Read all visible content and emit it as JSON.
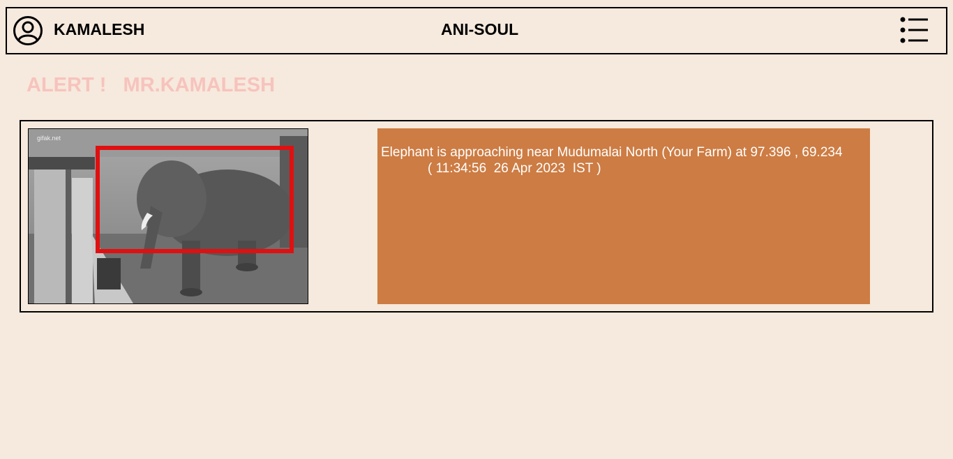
{
  "header": {
    "user_icon": "user-circle-icon",
    "user_name": "KAMALESH",
    "brand": "ANI-SOUL",
    "menu_icon": "list-menu-icon"
  },
  "alert": {
    "title": "ALERT !   MR.KAMALESH"
  },
  "card": {
    "image_alt": "Detected elephant snapshot",
    "image_watermark": "gifak.net",
    "detection_box_color": "#e01010",
    "message_line1": "Elephant is approaching near Mudumalai North (Your Farm) at 97.396 , 69.234",
    "message_line2": "( 11:34:56  26 Apr 2023  IST )",
    "message_bg": "#cd7c43"
  }
}
